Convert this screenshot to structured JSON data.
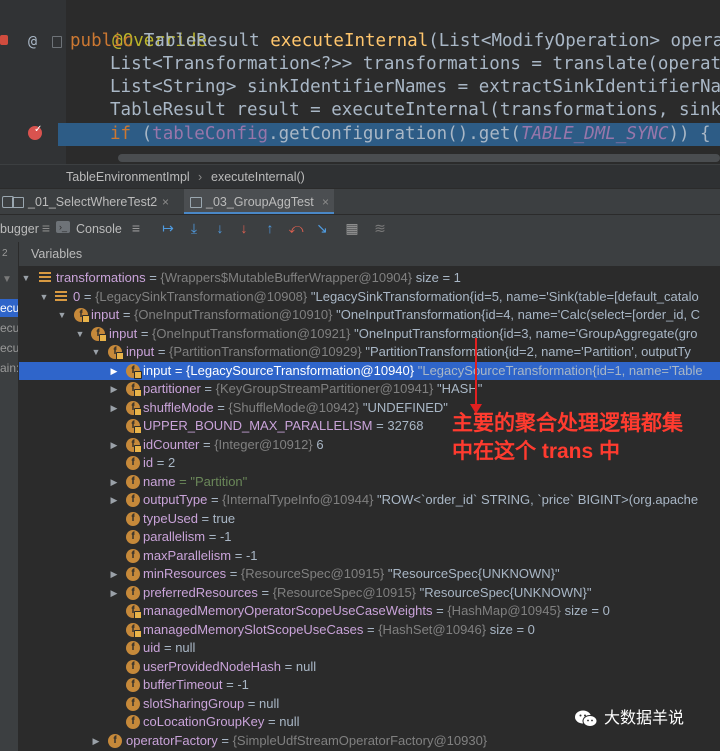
{
  "editor": {
    "lines": {
      "l1": {
        "annotation": "@Override"
      },
      "l2": {
        "kw1": "public",
        "t1": " TableResult ",
        "fn": "executeInternal",
        "t2": "(List<ModifyOperation> operations"
      },
      "l3": {
        "t": "List<Transformation<?>> transformations = translate(operations)"
      },
      "l4": {
        "t": "List<String> sinkIdentifierNames = extractSinkIdentifierNames(o"
      },
      "l5": {
        "t": "TableResult result = executeInternal(transformations, sinkIdent"
      },
      "l6": {
        "kw": "if",
        "t1": " (",
        "fld": "tableConfig",
        "t2": ".getConfiguration().get(",
        "cst": "TABLE_DML_SYNC",
        "t3": ")) {  ",
        "hint": "tabl"
      }
    },
    "gutter": {
      "at_marker": "@"
    }
  },
  "breadcrumb": {
    "class_name": "TableEnvironmentImpl",
    "separator": "›",
    "method": "executeInternal()"
  },
  "run_tabs": [
    {
      "label": "_01_SelectWhereTest2"
    },
    {
      "label": "_03_GroupAggTest"
    }
  ],
  "debugger_toolbar": {
    "debugger_label": "bugger",
    "console_label": "Console",
    "threads_count": "2"
  },
  "frames": [
    "ecu",
    "ecu",
    "ecu",
    "ain:"
  ],
  "variables": {
    "title": "Variables",
    "rows": [
      {
        "name": "transformations",
        "ref": "{Wrappers$MutableBufferWrapper@10904}",
        "value": "size = 1"
      },
      {
        "name": "0",
        "ref": "{LegacySinkTransformation@10908}",
        "value": "\"LegacySinkTransformation{id=5, name='Sink(table=[default_catalo"
      },
      {
        "name": "input",
        "ref": "{OneInputTransformation@10910}",
        "value": "\"OneInputTransformation{id=4, name='Calc(select=[order_id, C"
      },
      {
        "name": "input",
        "ref": "{OneInputTransformation@10921}",
        "value": "\"OneInputTransformation{id=3, name='GroupAggregate(gro"
      },
      {
        "name": "input",
        "ref": "{PartitionTransformation@10929}",
        "value": "\"PartitionTransformation{id=2, name='Partition', outputTy"
      },
      {
        "name": "input",
        "ref": "{LegacySourceTransformation@10940}",
        "value": "\"LegacySourceTransformation{id=1, name='Table"
      },
      {
        "name": "partitioner",
        "ref": "{KeyGroupStreamPartitioner@10941}",
        "value": "\"HASH\""
      },
      {
        "name": "shuffleMode",
        "ref": "{ShuffleMode@10942}",
        "value": "\"UNDEFINED\""
      },
      {
        "name": "UPPER_BOUND_MAX_PARALLELISM",
        "ref": "",
        "value": "= 32768"
      },
      {
        "name": "idCounter",
        "ref": "{Integer@10912}",
        "value": "6"
      },
      {
        "name": "id",
        "ref": "",
        "value": "= 2"
      },
      {
        "name": "name",
        "ref": "",
        "value": "= \"Partition\""
      },
      {
        "name": "outputType",
        "ref": "{InternalTypeInfo@10944}",
        "value": "\"ROW<`order_id` STRING, `price` BIGINT>(org.apache"
      },
      {
        "name": "typeUsed",
        "ref": "",
        "value": "= true"
      },
      {
        "name": "parallelism",
        "ref": "",
        "value": "= -1"
      },
      {
        "name": "maxParallelism",
        "ref": "",
        "value": "= -1"
      },
      {
        "name": "minResources",
        "ref": "{ResourceSpec@10915}",
        "value": "\"ResourceSpec{UNKNOWN}\""
      },
      {
        "name": "preferredResources",
        "ref": "{ResourceSpec@10915}",
        "value": "\"ResourceSpec{UNKNOWN}\""
      },
      {
        "name": "managedMemoryOperatorScopeUseCaseWeights",
        "ref": "{HashMap@10945}",
        "value": "size = 0"
      },
      {
        "name": "managedMemorySlotScopeUseCases",
        "ref": "{HashSet@10946}",
        "value": "size = 0"
      },
      {
        "name": "uid",
        "ref": "",
        "value": "= null"
      },
      {
        "name": "userProvidedNodeHash",
        "ref": "",
        "value": "= null"
      },
      {
        "name": "bufferTimeout",
        "ref": "",
        "value": "= -1"
      },
      {
        "name": "slotSharingGroup",
        "ref": "",
        "value": "= null"
      },
      {
        "name": "coLocationGroupKey",
        "ref": "",
        "value": "= null"
      },
      {
        "name": "operatorFactory",
        "ref": "{SimpleUdfStreamOperatorFactory@10930}",
        "value": ""
      }
    ]
  },
  "annotation": {
    "line1": "主要的聚合处理逻辑都集",
    "line2": "中在这个 trans 中"
  },
  "watermark": {
    "text": "大数据羊说"
  },
  "colors": {
    "selection": "#2f65ca",
    "annotation": "#e02020",
    "accent_tab": "#4a88c7"
  }
}
